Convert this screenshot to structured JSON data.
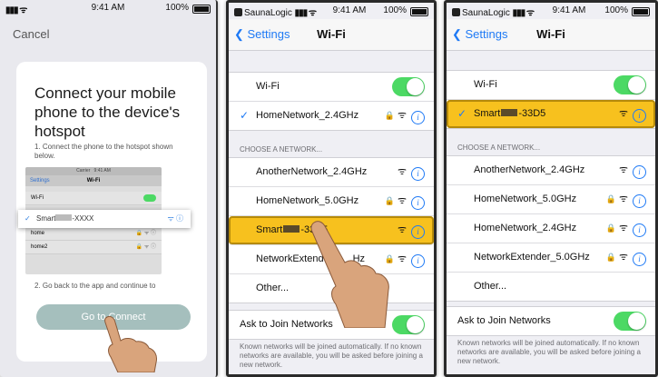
{
  "panel1": {
    "status": {
      "time": "9:41 AM",
      "battery": "100%"
    },
    "cancel": "Cancel",
    "heading": "Connect your mobile phone to the device's hotspot",
    "step1": "1. Connect the phone to the hotspot shown below.",
    "mini": {
      "carrier": "Carrier",
      "time": "9:41 AM",
      "back": "Settings",
      "title": "Wi-Fi",
      "wifi": "Wi-Fi",
      "selected_prefix": "Smart",
      "selected_suffix": "-XXXX",
      "section": "CHOOSE A NETWORK...",
      "rows": [
        "home",
        "home2"
      ]
    },
    "step2": "2. Go back to the app and continue to",
    "button": "Go to Connect"
  },
  "panel2": {
    "status": {
      "app": "SaunaLogic",
      "time": "9:41 AM",
      "battery": "100%"
    },
    "back": "Settings",
    "title": "Wi-Fi",
    "wifi_label": "Wi-Fi",
    "connected": "HomeNetwork_2.4GHz",
    "section": "CHOOSE A NETWORK...",
    "networks": [
      {
        "name": "AnotherNetwork_2.4GHz"
      },
      {
        "name": "HomeNetwork_5.0GHz"
      },
      {
        "prefix": "Smart",
        "suffix": "-33D5"
      },
      {
        "prefix": "NetworkExtend",
        "suffix": "Hz"
      },
      {
        "name": "Other..."
      }
    ],
    "ask": "Ask to Join Networks",
    "footer": "Known networks will be joined automatically. If no known networks are available, you will be asked before joining a new network."
  },
  "panel3": {
    "status": {
      "app": "SaunaLogic",
      "time": "9:41 AM",
      "battery": "100%"
    },
    "back": "Settings",
    "title": "Wi-Fi",
    "wifi_label": "Wi-Fi",
    "connected_prefix": "Smart",
    "connected_suffix": "-33D5",
    "section": "CHOOSE A NETWORK...",
    "networks": [
      {
        "name": "AnotherNetwork_2.4GHz"
      },
      {
        "name": "HomeNetwork_5.0GHz"
      },
      {
        "name": "HomeNetwork_2.4GHz"
      },
      {
        "name": "NetworkExtender_5.0GHz"
      },
      {
        "name": "Other..."
      }
    ],
    "ask": "Ask to Join Networks",
    "footer": "Known networks will be joined automatically. If no known networks are available, you will be asked before joining a new network."
  },
  "icons": {
    "wifi": "wifi-icon",
    "lock": "lock-icon",
    "info": "info-icon",
    "check": "checkmark-icon",
    "hand": "pointing-hand-icon"
  },
  "colors": {
    "ios_blue": "#1f7af5",
    "toggle_green": "#4cd964",
    "highlight": "#f7c11e",
    "button": "#a5bfbd"
  }
}
